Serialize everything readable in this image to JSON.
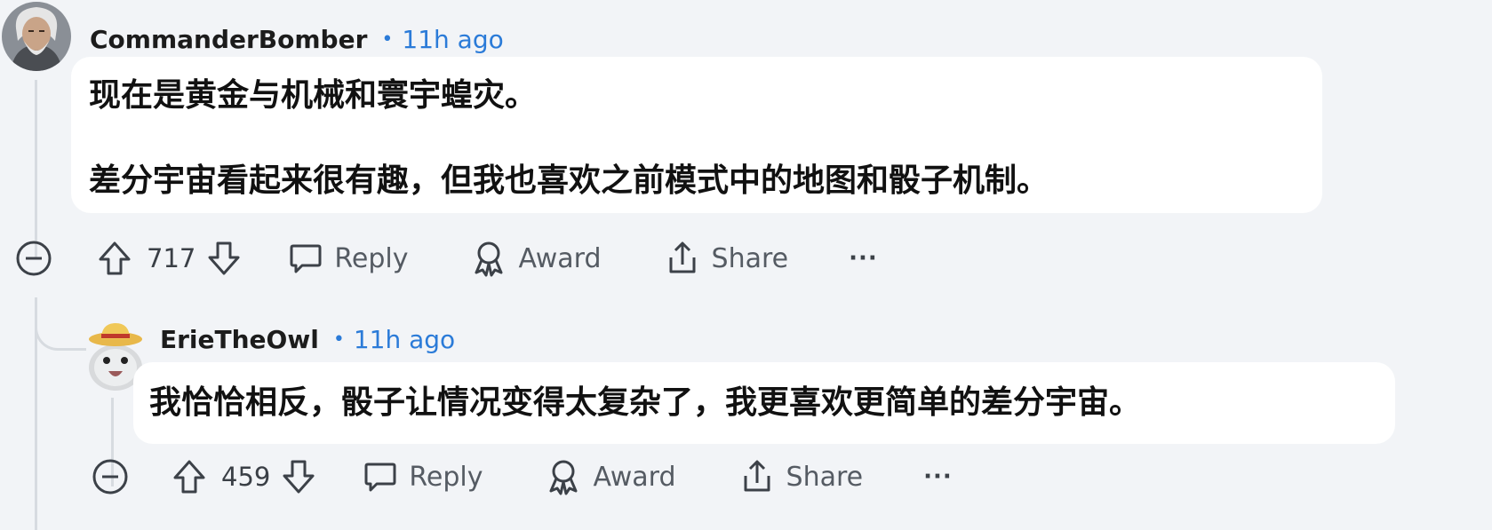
{
  "comments": [
    {
      "username": "CommanderBomber",
      "separator": "•",
      "time": "11h ago",
      "paragraphs": [
        "现在是黄金与机械和寰宇蝗灾。",
        "差分宇宙看起来很有趣，但我也喜欢之前模式中的地图和骰子机制。"
      ],
      "score": "717",
      "reply_label": "Reply",
      "award_label": "Award",
      "share_label": "Share",
      "more_label": "···"
    },
    {
      "username": "ErieTheOwl",
      "separator": "•",
      "time": "11h ago",
      "paragraphs": [
        "我恰恰相反，骰子让情况变得太复杂了，我更喜欢更简单的差分宇宙。"
      ],
      "score": "459",
      "reply_label": "Reply",
      "award_label": "Award",
      "share_label": "Share",
      "more_label": "···"
    }
  ],
  "colors": {
    "accent": "#2b7bd8",
    "background": "#f2f4f7",
    "card": "#ffffff",
    "icon": "#555b63"
  }
}
